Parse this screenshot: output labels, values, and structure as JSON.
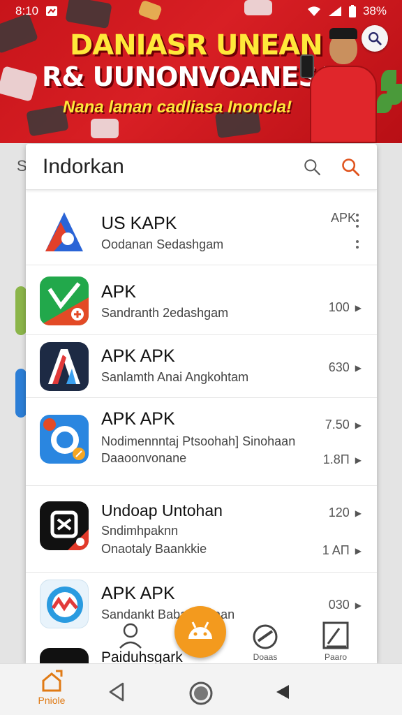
{
  "status": {
    "time": "8:10",
    "battery": "38%"
  },
  "banner": {
    "title_line1": "DANIASR UNEAN",
    "title_line2": "R& UUNONVOANESAI",
    "subtitle": "Nana lanan cadliasa Inoncla!"
  },
  "background": {
    "letter": "S"
  },
  "card": {
    "title": "Indorkan"
  },
  "apps": [
    {
      "name": "US KAPK",
      "line1": "Oodanan Sedashgam",
      "line2": "",
      "meta1": "APK",
      "meta2": ""
    },
    {
      "name": "APK",
      "line1": "Sandranth 2edashgam",
      "line2": "",
      "meta1": "100",
      "meta2": ""
    },
    {
      "name": "APK APK",
      "line1": "Sanlamth Anai Angkohtam",
      "line2": "",
      "meta1": "630",
      "meta2": ""
    },
    {
      "name": "APK APK",
      "line1": "Nodimennntaj Ptsoohah] Sinohaan",
      "line2": "Daaoonvonane",
      "meta1": "7.50",
      "meta2": "1.8Π"
    },
    {
      "name": "Undoap Untohan",
      "line1": "Sndimhpaknn",
      "line2": "Onaotaly Baankkie",
      "meta1": "120",
      "meta2": "1 AΠ"
    },
    {
      "name": "APK APK",
      "line1": "Sandankt Babanmlkaan",
      "line2": "",
      "meta1": "030",
      "meta2": ""
    },
    {
      "name": "Paiduhsgark",
      "line1": "",
      "line2": "",
      "meta1": "",
      "meta2": ""
    }
  ],
  "bottom_tabs": {
    "tab3_label": "Doaas",
    "tab4_label": "Paaro"
  },
  "navbar": {
    "home_label": "Pniole"
  },
  "colors": {
    "accent": "#f39a1e",
    "banner_red": "#d81f24",
    "banner_yellow": "#ffe83a"
  }
}
